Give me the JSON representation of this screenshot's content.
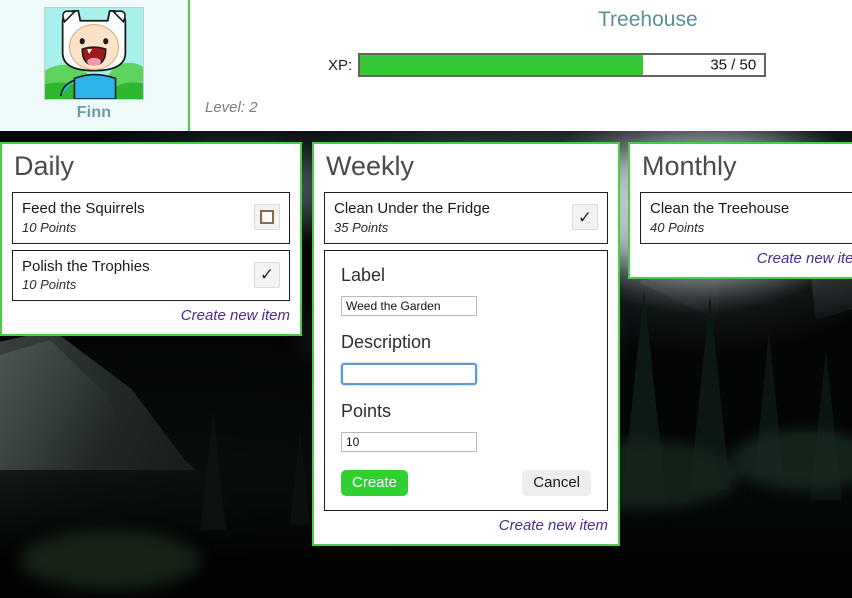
{
  "header": {
    "app_title": "Treehouse",
    "avatar_name": "Finn",
    "avatar_icon": "finn-adventure-time-avatar",
    "xp_label": "XP:",
    "xp_current": 35,
    "xp_max": 50,
    "xp_text": "35 / 50",
    "xp_percent": 70,
    "level_text": "Level: 2",
    "colors": {
      "xp_fill": "#37c837",
      "panel_border": "#49cd49",
      "title": "#5b8f99",
      "avatar_panel_bg": "#eefbfa"
    }
  },
  "columns": [
    {
      "title": "Daily",
      "create_link": "Create new item",
      "tasks": [
        {
          "label": "Feed the Squirrels",
          "points": "10 Points",
          "checked": false,
          "check_icon": "empty-checkbox-icon"
        },
        {
          "label": "Polish the Trophies",
          "points": "10 Points",
          "checked": true,
          "check_icon": "checkmark-icon"
        }
      ]
    },
    {
      "title": "Weekly",
      "create_link": "Create new item",
      "tasks": [
        {
          "label": "Clean Under the Fridge",
          "points": "35 Points",
          "checked": true,
          "check_icon": "checkmark-icon"
        }
      ],
      "form": {
        "label_heading": "Label",
        "label_value": "Weed the Garden",
        "description_heading": "Description",
        "description_value": "",
        "description_focused": true,
        "points_heading": "Points",
        "points_value": "10",
        "create_button": "Create",
        "cancel_button": "Cancel"
      }
    },
    {
      "title": "Monthly",
      "create_link": "Create new item",
      "tasks": [
        {
          "label": "Clean the Treehouse",
          "points": "40 Points",
          "checked": false,
          "check_icon": "none"
        }
      ]
    }
  ],
  "check_glyphs": {
    "checked": "✓",
    "unchecked": ""
  }
}
